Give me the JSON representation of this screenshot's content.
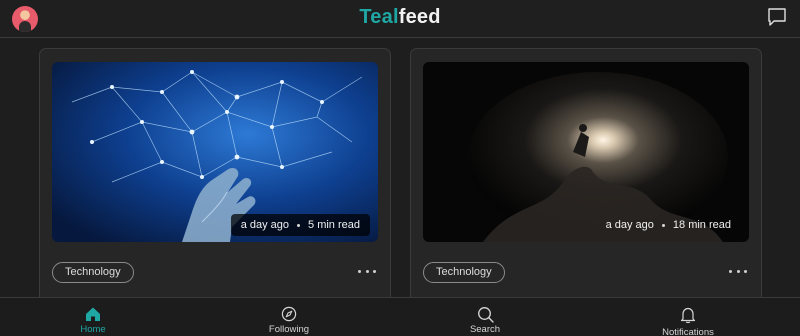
{
  "app": {
    "brand_part1": "Teal",
    "brand_part2": "feed",
    "accent_color": "#1fa7a4"
  },
  "header": {
    "avatar_icon": "user-avatar",
    "chat_icon": "chat-bubble-icon"
  },
  "cards": [
    {
      "image_subject": "robot-hand-network-image",
      "time_ago": "a day ago",
      "read_time": "5 min read",
      "tag": "Technology"
    },
    {
      "image_subject": "cave-light-image",
      "time_ago": "a day ago",
      "read_time": "18 min read",
      "tag": "Technology"
    }
  ],
  "nav": {
    "items": [
      {
        "label": "Home",
        "icon": "home-icon",
        "active": true
      },
      {
        "label": "Following",
        "icon": "compass-icon",
        "active": false
      },
      {
        "label": "Search",
        "icon": "search-icon",
        "active": false
      },
      {
        "label": "Notifications",
        "icon": "bell-icon",
        "active": false
      }
    ]
  }
}
